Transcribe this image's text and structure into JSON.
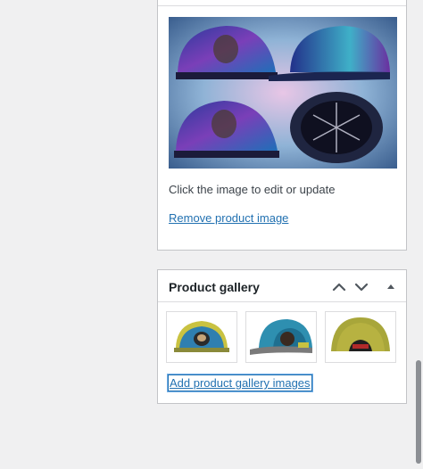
{
  "featured": {
    "image_alt": "featured product image",
    "hint": "Click the image to edit or update",
    "remove_label": "Remove product image"
  },
  "gallery": {
    "title": "Product gallery",
    "move_up_icon": "chevron-up-icon",
    "move_down_icon": "chevron-down-icon",
    "toggle_icon": "caret-up-icon",
    "add_label": "Add product gallery images",
    "thumbnails": [
      "gallery image 1",
      "gallery image 2",
      "gallery image 3"
    ]
  },
  "colors": {
    "link": "#2271b1",
    "border": "#c3c4c7",
    "background": "#f0f0f1"
  }
}
